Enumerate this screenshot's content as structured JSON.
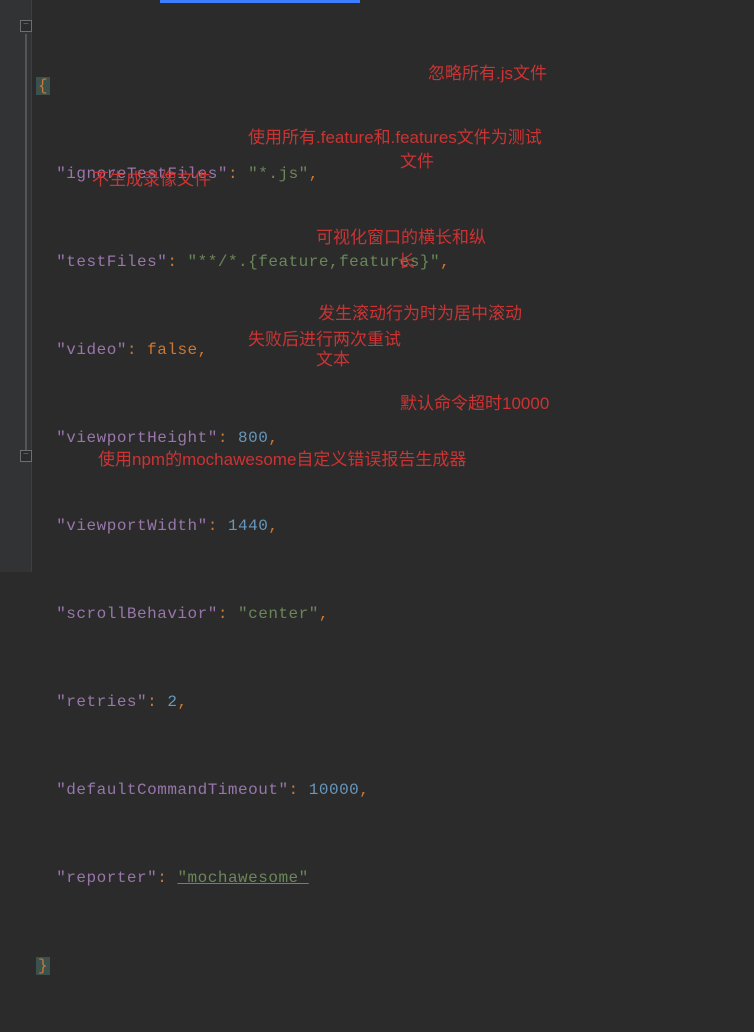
{
  "code": {
    "open_brace": "{",
    "close_brace": "}",
    "lines": {
      "ignoreTestFiles": {
        "key": "\"ignoreTestFiles\"",
        "colon": ":",
        "value": "\"*.js\"",
        "comma": ","
      },
      "testFiles": {
        "key": "\"testFiles\"",
        "colon": ":",
        "value": "\"**/*.{feature,features}\"",
        "comma": ","
      },
      "video": {
        "key": "\"video\"",
        "colon": ":",
        "value": "false",
        "comma": ","
      },
      "viewportHeight": {
        "key": "\"viewportHeight\"",
        "colon": ":",
        "value": "800",
        "comma": ","
      },
      "viewportWidth": {
        "key": "\"viewportWidth\"",
        "colon": ":",
        "value": "1440",
        "comma": ","
      },
      "scrollBehavior": {
        "key": "\"scrollBehavior\"",
        "colon": ":",
        "value": "\"center\"",
        "comma": ","
      },
      "retries": {
        "key": "\"retries\"",
        "colon": ":",
        "value": "2",
        "comma": ","
      },
      "defaultCommandTimeout": {
        "key": "\"defaultCommandTimeout\"",
        "colon": ":",
        "value": "10000",
        "comma": ","
      },
      "reporter": {
        "key": "\"reporter\"",
        "colon": ":",
        "value": "\"mochawesome\"",
        "comma": ""
      }
    }
  },
  "annotations": {
    "a1": "忽略所有.js文件",
    "a2a": "使用所有.feature和.features文件为测试",
    "a2b": "文件",
    "a3": "不生成录像文件",
    "a4a": "可视化窗口的横长和纵",
    "a4b": "长",
    "a5": "发生滚动行为时为居中滚动",
    "a6a": "失败后进行两次重试",
    "a6b": "文本",
    "a7": "默认命令超时10000",
    "a8": "使用npm的mochawesome自定义错误报告生成器"
  }
}
